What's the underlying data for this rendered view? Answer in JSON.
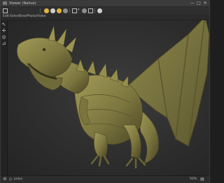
{
  "window": {
    "title": "Viewer (Native)",
    "controls": {
      "minimize": "—",
      "maximize": "□",
      "close": "✕"
    }
  },
  "toolbar": {
    "icons": [
      "sphere-icon",
      "sphere-yellow-icon",
      "camera-icon",
      "light-icon",
      "sphere-dark-icon",
      "frame-icon",
      "transform-icon"
    ]
  },
  "menubar": {
    "items": [
      "Edit",
      "Select",
      "View",
      "Photo/Video"
    ]
  },
  "left_tools": {
    "icons": [
      "arrow-icon",
      "move-icon",
      "rotate-icon",
      "scale-icon"
    ]
  },
  "statusbar": {
    "left_icon": "settings-icon",
    "label": "polys",
    "zoom": "50%"
  },
  "colors": {
    "model": "#7d7740",
    "model_light": "#a8a05a",
    "model_dark": "#4a4524"
  }
}
